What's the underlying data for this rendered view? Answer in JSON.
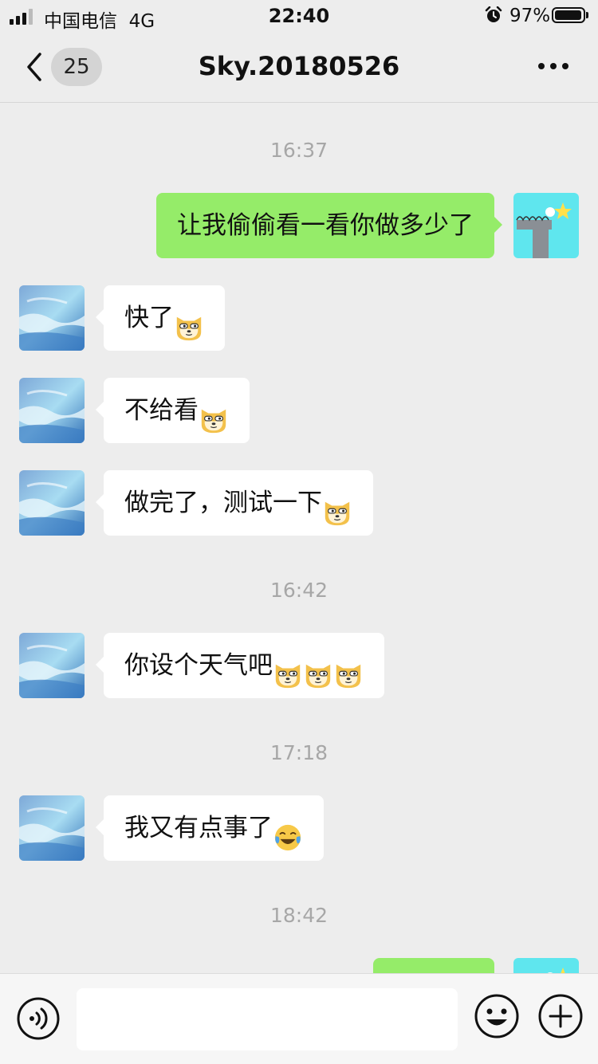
{
  "status_bar": {
    "carrier": "中国电信",
    "network": "4G",
    "time": "22:40",
    "battery_percent": "97%",
    "battery_level": 0.97
  },
  "nav": {
    "unread_count": "25",
    "title": "Sky.20180526"
  },
  "messages": [
    {
      "type": "time",
      "text": "16:37"
    },
    {
      "type": "msg",
      "side": "self",
      "text": "让我偷偷看一看你做多少了",
      "emojis": []
    },
    {
      "type": "msg",
      "side": "peer",
      "text": "快了",
      "emojis": [
        "doge-emoji"
      ]
    },
    {
      "type": "msg",
      "side": "peer",
      "text": "不给看",
      "emojis": [
        "doge-emoji"
      ]
    },
    {
      "type": "msg",
      "side": "peer",
      "text": "做完了，测试一下",
      "emojis": [
        "doge-emoji"
      ]
    },
    {
      "type": "time",
      "text": "16:42"
    },
    {
      "type": "msg",
      "side": "peer",
      "text": "你设个天气吧",
      "emojis": [
        "doge-emoji",
        "doge-emoji",
        "doge-emoji"
      ]
    },
    {
      "type": "time",
      "text": "17:18"
    },
    {
      "type": "msg",
      "side": "peer",
      "text": "我又有点事了",
      "emojis": [
        "laugh-cry-emoji"
      ]
    },
    {
      "type": "time",
      "text": "18:42"
    },
    {
      "type": "msg",
      "side": "self",
      "text": "",
      "emojis": []
    }
  ],
  "input": {
    "value": "",
    "placeholder": ""
  },
  "colors": {
    "self_bubble": "#95ec69",
    "peer_bubble": "#ffffff",
    "background": "#ededed",
    "time_label": "#a7a7a7"
  }
}
